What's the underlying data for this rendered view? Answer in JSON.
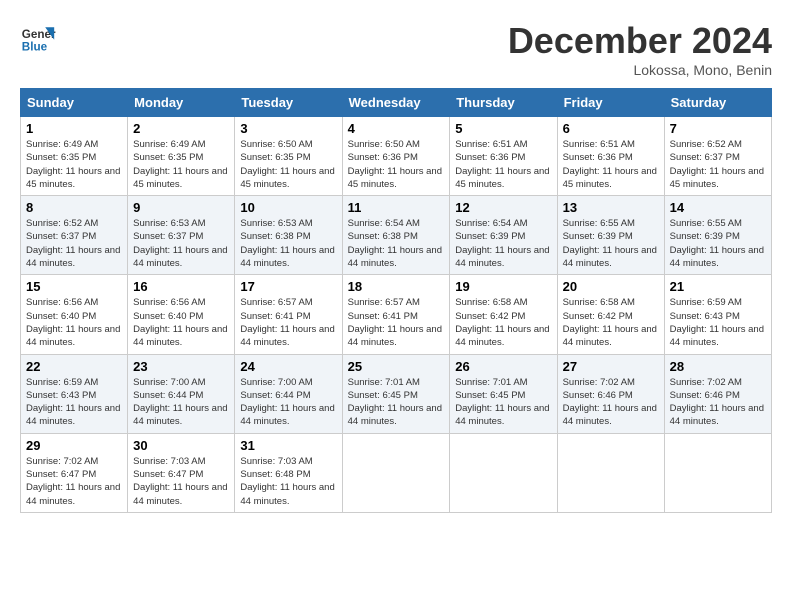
{
  "logo": {
    "line1": "General",
    "line2": "Blue"
  },
  "title": "December 2024",
  "location": "Lokossa, Mono, Benin",
  "days_of_week": [
    "Sunday",
    "Monday",
    "Tuesday",
    "Wednesday",
    "Thursday",
    "Friday",
    "Saturday"
  ],
  "weeks": [
    [
      {
        "day": "1",
        "sunrise": "6:49 AM",
        "sunset": "6:35 PM",
        "daylight": "11 hours and 45 minutes."
      },
      {
        "day": "2",
        "sunrise": "6:49 AM",
        "sunset": "6:35 PM",
        "daylight": "11 hours and 45 minutes."
      },
      {
        "day": "3",
        "sunrise": "6:50 AM",
        "sunset": "6:35 PM",
        "daylight": "11 hours and 45 minutes."
      },
      {
        "day": "4",
        "sunrise": "6:50 AM",
        "sunset": "6:36 PM",
        "daylight": "11 hours and 45 minutes."
      },
      {
        "day": "5",
        "sunrise": "6:51 AM",
        "sunset": "6:36 PM",
        "daylight": "11 hours and 45 minutes."
      },
      {
        "day": "6",
        "sunrise": "6:51 AM",
        "sunset": "6:36 PM",
        "daylight": "11 hours and 45 minutes."
      },
      {
        "day": "7",
        "sunrise": "6:52 AM",
        "sunset": "6:37 PM",
        "daylight": "11 hours and 45 minutes."
      }
    ],
    [
      {
        "day": "8",
        "sunrise": "6:52 AM",
        "sunset": "6:37 PM",
        "daylight": "11 hours and 44 minutes."
      },
      {
        "day": "9",
        "sunrise": "6:53 AM",
        "sunset": "6:37 PM",
        "daylight": "11 hours and 44 minutes."
      },
      {
        "day": "10",
        "sunrise": "6:53 AM",
        "sunset": "6:38 PM",
        "daylight": "11 hours and 44 minutes."
      },
      {
        "day": "11",
        "sunrise": "6:54 AM",
        "sunset": "6:38 PM",
        "daylight": "11 hours and 44 minutes."
      },
      {
        "day": "12",
        "sunrise": "6:54 AM",
        "sunset": "6:39 PM",
        "daylight": "11 hours and 44 minutes."
      },
      {
        "day": "13",
        "sunrise": "6:55 AM",
        "sunset": "6:39 PM",
        "daylight": "11 hours and 44 minutes."
      },
      {
        "day": "14",
        "sunrise": "6:55 AM",
        "sunset": "6:39 PM",
        "daylight": "11 hours and 44 minutes."
      }
    ],
    [
      {
        "day": "15",
        "sunrise": "6:56 AM",
        "sunset": "6:40 PM",
        "daylight": "11 hours and 44 minutes."
      },
      {
        "day": "16",
        "sunrise": "6:56 AM",
        "sunset": "6:40 PM",
        "daylight": "11 hours and 44 minutes."
      },
      {
        "day": "17",
        "sunrise": "6:57 AM",
        "sunset": "6:41 PM",
        "daylight": "11 hours and 44 minutes."
      },
      {
        "day": "18",
        "sunrise": "6:57 AM",
        "sunset": "6:41 PM",
        "daylight": "11 hours and 44 minutes."
      },
      {
        "day": "19",
        "sunrise": "6:58 AM",
        "sunset": "6:42 PM",
        "daylight": "11 hours and 44 minutes."
      },
      {
        "day": "20",
        "sunrise": "6:58 AM",
        "sunset": "6:42 PM",
        "daylight": "11 hours and 44 minutes."
      },
      {
        "day": "21",
        "sunrise": "6:59 AM",
        "sunset": "6:43 PM",
        "daylight": "11 hours and 44 minutes."
      }
    ],
    [
      {
        "day": "22",
        "sunrise": "6:59 AM",
        "sunset": "6:43 PM",
        "daylight": "11 hours and 44 minutes."
      },
      {
        "day": "23",
        "sunrise": "7:00 AM",
        "sunset": "6:44 PM",
        "daylight": "11 hours and 44 minutes."
      },
      {
        "day": "24",
        "sunrise": "7:00 AM",
        "sunset": "6:44 PM",
        "daylight": "11 hours and 44 minutes."
      },
      {
        "day": "25",
        "sunrise": "7:01 AM",
        "sunset": "6:45 PM",
        "daylight": "11 hours and 44 minutes."
      },
      {
        "day": "26",
        "sunrise": "7:01 AM",
        "sunset": "6:45 PM",
        "daylight": "11 hours and 44 minutes."
      },
      {
        "day": "27",
        "sunrise": "7:02 AM",
        "sunset": "6:46 PM",
        "daylight": "11 hours and 44 minutes."
      },
      {
        "day": "28",
        "sunrise": "7:02 AM",
        "sunset": "6:46 PM",
        "daylight": "11 hours and 44 minutes."
      }
    ],
    [
      {
        "day": "29",
        "sunrise": "7:02 AM",
        "sunset": "6:47 PM",
        "daylight": "11 hours and 44 minutes."
      },
      {
        "day": "30",
        "sunrise": "7:03 AM",
        "sunset": "6:47 PM",
        "daylight": "11 hours and 44 minutes."
      },
      {
        "day": "31",
        "sunrise": "7:03 AM",
        "sunset": "6:48 PM",
        "daylight": "11 hours and 44 minutes."
      },
      null,
      null,
      null,
      null
    ]
  ]
}
